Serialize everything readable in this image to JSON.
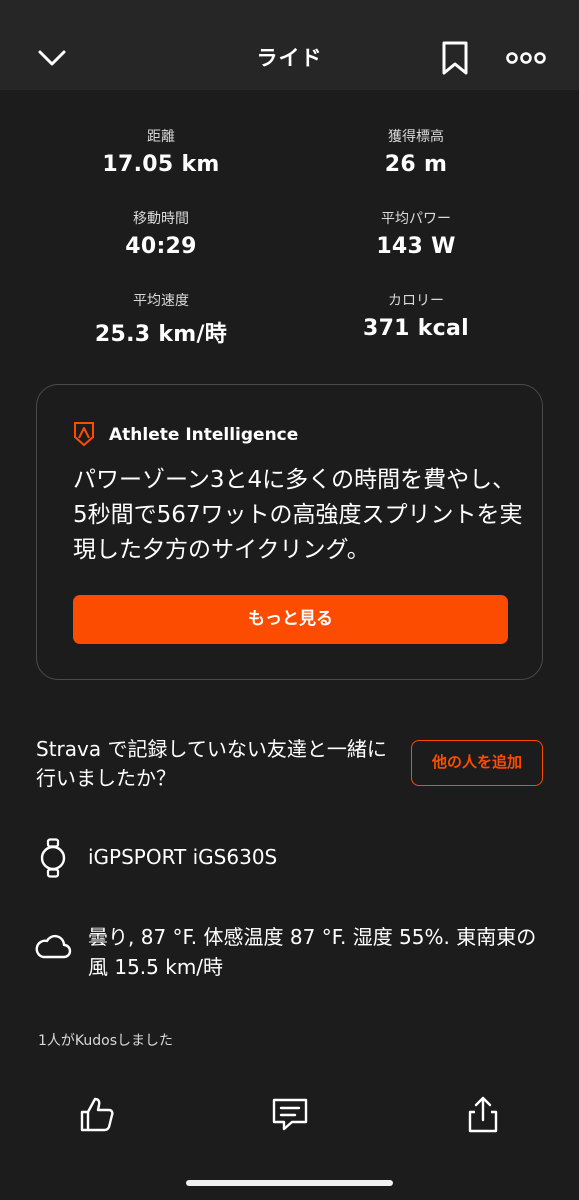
{
  "header": {
    "title": "ライド",
    "back_icon": "chevron-down-icon",
    "bookmark_icon": "bookmark-icon",
    "more_icon": "more-horizontal-icon"
  },
  "stats": {
    "distance": {
      "label": "距離",
      "value": "17.05 km"
    },
    "elevation": {
      "label": "獲得標高",
      "value": "26 m"
    },
    "moving_time": {
      "label": "移動時間",
      "value": "40:29"
    },
    "avg_power": {
      "label": "平均パワー",
      "value": "143 W"
    },
    "avg_speed": {
      "label": "平均速度",
      "value": "25.3 km/時"
    },
    "calories": {
      "label": "カロリー",
      "value": "371 kcal"
    }
  },
  "athlete_intelligence": {
    "title": "Athlete Intelligence",
    "summary": "パワーゾーン3と4に多くの時間を費やし、5秒間で567ワットの高強度スプリントを実現した夕方のサイクリング。",
    "more_label": "もっと見る"
  },
  "friends": {
    "prompt": "Strava で記録していない友達と一緒に行いましたか？",
    "add_label": "他の人を追加"
  },
  "device": {
    "name": "iGPSPORT iGS630S",
    "icon": "watch-icon"
  },
  "weather": {
    "text": "曇り, 87 °F. 体感温度 87 °F. 湿度 55%. 東南東の風 15.5 km/時",
    "icon": "cloud-icon"
  },
  "kudos": {
    "text": "1人がKudosしました"
  },
  "actions": {
    "like_icon": "thumbs-up-icon",
    "comment_icon": "comment-icon",
    "share_icon": "share-icon"
  },
  "colors": {
    "accent": "#fc4c02",
    "background": "#1c1c1c",
    "header": "#262626"
  }
}
